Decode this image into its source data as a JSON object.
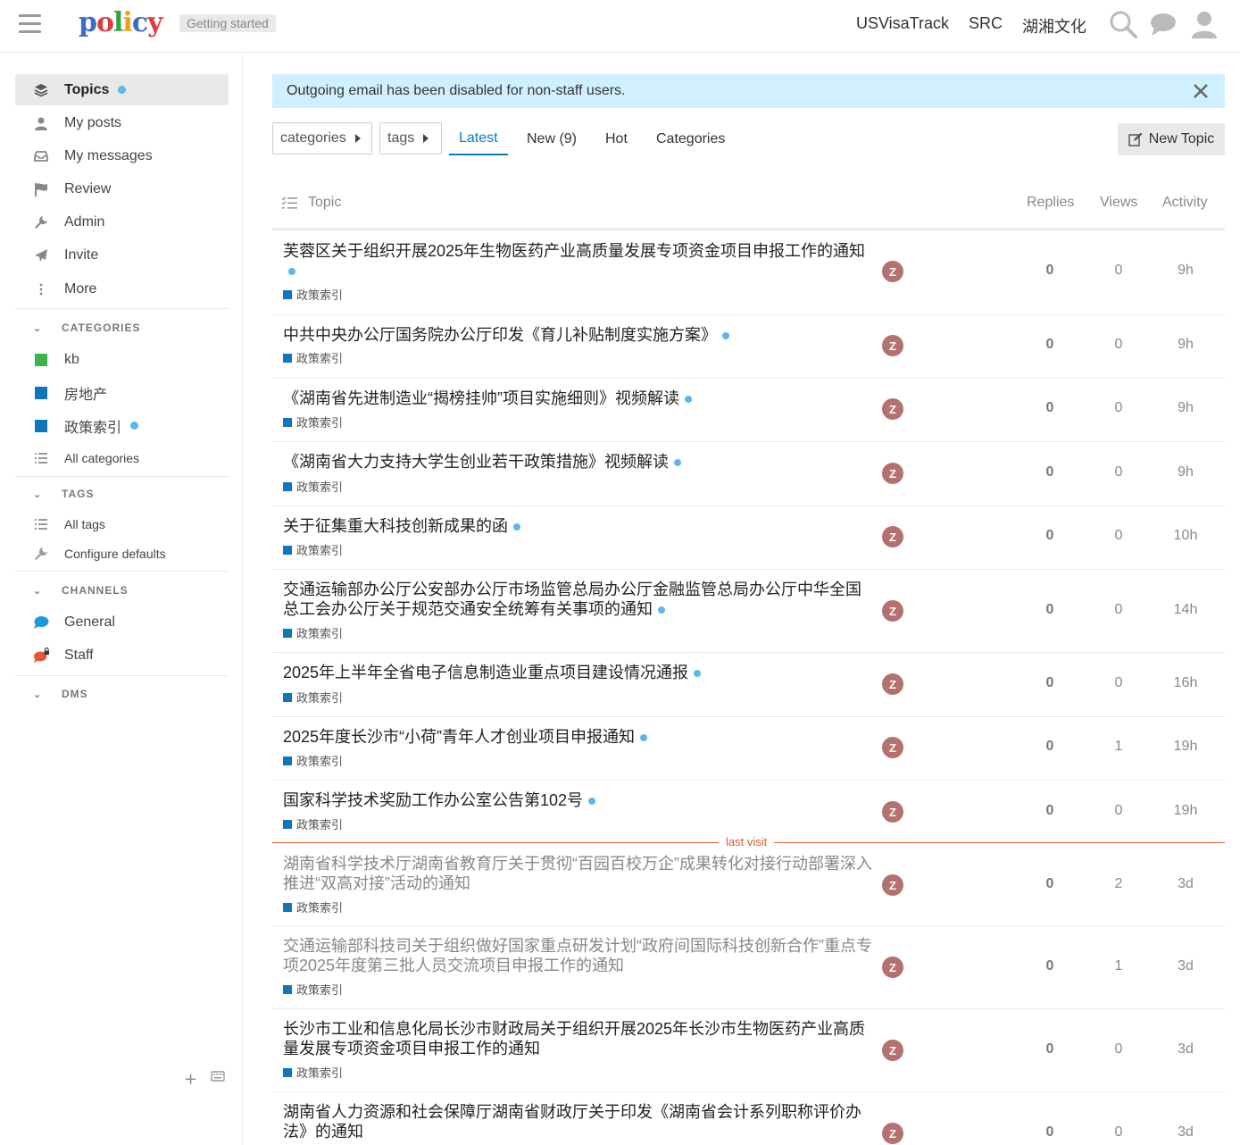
{
  "header": {
    "logo_text": "policy",
    "getting_started": "Getting started",
    "links": [
      "USVisaTrack",
      "SRC",
      "湖湘文化"
    ]
  },
  "sidebar": {
    "main_items": [
      {
        "label": "Topics",
        "icon": "layers-icon",
        "active": true,
        "unread": true
      },
      {
        "label": "My posts",
        "icon": "user-icon"
      },
      {
        "label": "My messages",
        "icon": "inbox-icon"
      },
      {
        "label": "Review",
        "icon": "flag-icon"
      },
      {
        "label": "Admin",
        "icon": "wrench-icon"
      },
      {
        "label": "Invite",
        "icon": "paper-plane-icon"
      },
      {
        "label": "More",
        "icon": "vertical-dots-icon"
      }
    ],
    "categories_header": "CATEGORIES",
    "categories": [
      {
        "label": "kb",
        "color": "#3ab54a"
      },
      {
        "label": "房地产",
        "color": "#0e76bd"
      },
      {
        "label": "政策索引",
        "color": "#0e76bd",
        "unread": true
      }
    ],
    "all_categories": "All categories",
    "tags_header": "TAGS",
    "all_tags": "All tags",
    "configure_defaults": "Configure defaults",
    "channels_header": "CHANNELS",
    "channels": [
      {
        "label": "General",
        "color": "#1d9ade"
      },
      {
        "label": "Staff",
        "color": "#e45735"
      }
    ],
    "dms_header": "DMS"
  },
  "alert": {
    "text": "Outgoing email has been disabled for non-staff users."
  },
  "nav": {
    "categories_dropdown": "categories",
    "tags_dropdown": "tags",
    "tabs": [
      "Latest",
      "New (9)",
      "Hot",
      "Categories"
    ],
    "active_tab": "Latest",
    "new_topic": "New Topic"
  },
  "table": {
    "headers": {
      "topic": "Topic",
      "replies": "Replies",
      "views": "Views",
      "activity": "Activity"
    },
    "last_visit_label": "last visit",
    "rows": [
      {
        "title": "芙蓉区关于组织开展2025年生物医药产业高质量发展专项资金项目申报工作的通知",
        "category": "政策索引",
        "avatar": "Z",
        "replies": "0",
        "views": "0",
        "activity": "9h",
        "unread": true
      },
      {
        "title": "中共中央办公厅国务院办公厅印发《育儿补贴制度实施方案》",
        "category": "政策索引",
        "avatar": "Z",
        "replies": "0",
        "views": "0",
        "activity": "9h",
        "unread": true
      },
      {
        "title": "《湖南省先进制造业“揭榜挂帅”项目实施细则》视频解读",
        "category": "政策索引",
        "avatar": "Z",
        "replies": "0",
        "views": "0",
        "activity": "9h",
        "unread": true
      },
      {
        "title": "《湖南省大力支持大学生创业若干政策措施》视频解读",
        "category": "政策索引",
        "avatar": "Z",
        "replies": "0",
        "views": "0",
        "activity": "9h",
        "unread": true
      },
      {
        "title": "关于征集重大科技创新成果的函",
        "category": "政策索引",
        "avatar": "Z",
        "replies": "0",
        "views": "0",
        "activity": "10h",
        "unread": true
      },
      {
        "title": "交通运输部办公厅公安部办公厅市场监管总局办公厅金融监管总局办公厅中华全国总工会办公厅关于规范交通安全统筹有关事项的通知",
        "category": "政策索引",
        "avatar": "Z",
        "replies": "0",
        "views": "0",
        "activity": "14h",
        "unread": true
      },
      {
        "title": "2025年上半年全省电子信息制造业重点项目建设情况通报",
        "category": "政策索引",
        "avatar": "Z",
        "replies": "0",
        "views": "0",
        "activity": "16h",
        "unread": true
      },
      {
        "title": "2025年度长沙市“小荷”青年人才创业项目申报通知",
        "category": "政策索引",
        "avatar": "Z",
        "replies": "0",
        "views": "1",
        "activity": "19h",
        "unread": true
      },
      {
        "title": "国家科学技术奖励工作办公室公告第102号",
        "category": "政策索引",
        "avatar": "Z",
        "replies": "0",
        "views": "0",
        "activity": "19h",
        "unread": true
      },
      {
        "title": "湖南省科学技术厅湖南省教育厅关于贯彻“百园百校万企”成果转化对接行动部署深入推进“双高对接”活动的通知",
        "category": "政策索引",
        "avatar": "Z",
        "replies": "0",
        "views": "2",
        "activity": "3d",
        "visited": true
      },
      {
        "title": "交通运输部科技司关于组织做好国家重点研发计划“政府间国际科技创新合作”重点专项2025年度第三批人员交流项目申报工作的通知",
        "category": "政策索引",
        "avatar": "Z",
        "replies": "0",
        "views": "1",
        "activity": "3d",
        "visited": true
      },
      {
        "title": "长沙市工业和信息化局长沙市财政局关于组织开展2025年长沙市生物医药产业高质量发展专项资金项目申报工作的通知",
        "category": "政策索引",
        "avatar": "Z",
        "replies": "0",
        "views": "0",
        "activity": "3d"
      },
      {
        "title": "湖南省人力资源和社会保障厅湖南省财政厅关于印发《湖南省会计系列职称评价办法》的通知",
        "category": "",
        "avatar": "Z",
        "replies": "0",
        "views": "0",
        "activity": "3d"
      }
    ]
  }
}
